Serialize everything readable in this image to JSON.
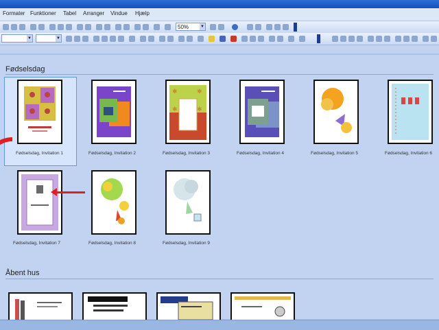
{
  "menubar": {
    "items": [
      "Formater",
      "Funktioner",
      "Tabel",
      "Arranger",
      "Vindue",
      "Hjælp"
    ]
  },
  "toolbar": {
    "zoom": "50%"
  },
  "gallery": {
    "sections": [
      {
        "title": "Fødselsdag",
        "items": [
          "Fødselsdag, Invitation 1",
          "Fødselsdag, Invitation 2",
          "Fødselsdag, Invitation 3",
          "Fødselsdag, Invitation 4",
          "Fødselsdag, Invitation 5",
          "Fødselsdag, Invitation 6",
          "Fødselsdag, Invitation 7",
          "Fødselsdag, Invitation 8",
          "Fødselsdag, Invitation 9"
        ]
      },
      {
        "title": "Åbent hus",
        "items": []
      }
    ],
    "selected_index": 0
  },
  "colors": {
    "accent": "#5c9ae4",
    "annotation": "#e21d1d",
    "background": "#c1d3f1"
  }
}
